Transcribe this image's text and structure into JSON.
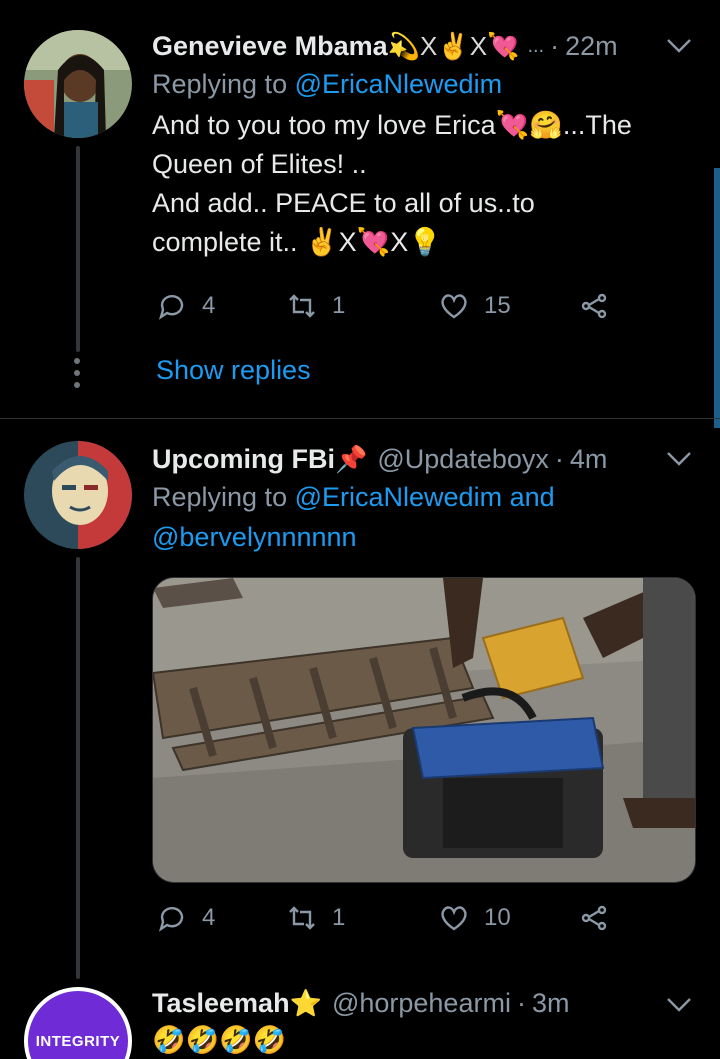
{
  "tweets": [
    {
      "name": "Genevieve Mbama",
      "name_emoji": "💫X✌X💘",
      "ellipsis": "...",
      "dot": "·",
      "time": "22m",
      "replying_prefix": "Replying to",
      "replying_to": "@EricaNlewedim",
      "text_lines": [
        "And to you too my love Erica💘🤗...The",
        "Queen of Elites! ..",
        "And add.. PEACE to all of us..to",
        "complete it.. ✌X💘X💡"
      ],
      "replies": "4",
      "retweets": "1",
      "likes": "15",
      "show_replies": "Show replies"
    },
    {
      "name": "Upcoming FBi",
      "name_emoji": "📌",
      "handle": "@Updateboyx",
      "dot": "·",
      "time": "4m",
      "replying_prefix": "Replying to",
      "replying_to_1": "@EricaNlewedim",
      "replying_and": "and",
      "replying_to_2": "@bervelynnnnnn",
      "replies": "4",
      "retweets": "1",
      "likes": "10"
    },
    {
      "name": "Tasleemah",
      "name_emoji": "⭐",
      "handle": "@horpehearmi",
      "dot": "·",
      "time": "3m",
      "avatar_text": "INTEGRITY",
      "text": "🤣🤣🤣🤣"
    }
  ],
  "icons": {
    "reply": "reply-icon",
    "retweet": "retweet-icon",
    "like": "heart-icon",
    "share": "share-icon",
    "menu": "chevron-down-icon"
  },
  "colors": {
    "background": "#000000",
    "accent": "#1d9bf0",
    "muted": "#8b98a5"
  }
}
